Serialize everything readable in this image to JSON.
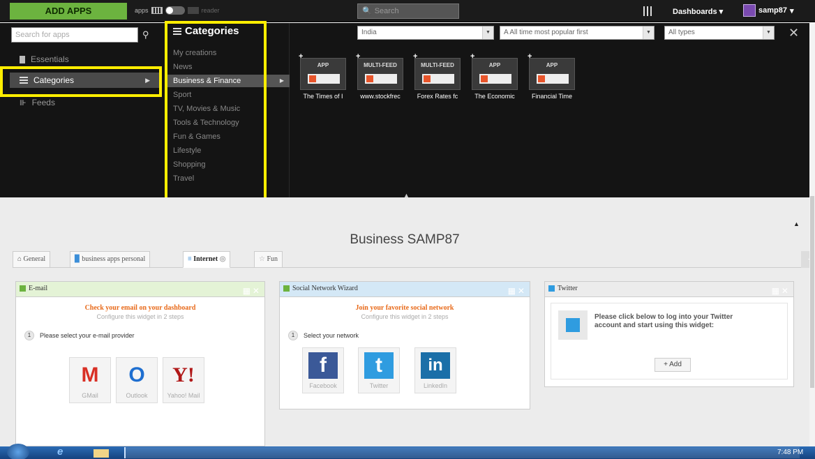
{
  "topbar": {
    "add_apps": "ADD APPS",
    "apps_label": "apps",
    "reader_label": "reader",
    "search_placeholder": "Search",
    "dashboards": "Dashboards",
    "user": "samp87"
  },
  "sidebar": {
    "search_placeholder": "Search for apps",
    "items": [
      {
        "label": "Essentials",
        "icon": "bookmark-icon"
      },
      {
        "label": "Categories",
        "icon": "list-icon",
        "selected": true
      },
      {
        "label": "Feeds",
        "icon": "rss-icon"
      }
    ]
  },
  "categories": {
    "title": "Categories",
    "items": [
      "My creations",
      "News",
      "Business & Finance",
      "Sport",
      "TV, Movies & Music",
      "Tools & Technology",
      "Fun & Games",
      "Lifestyle",
      "Shopping",
      "Travel"
    ],
    "selected": "Business & Finance"
  },
  "filters": {
    "region": "India",
    "sort": "All time most popular first",
    "sort_letter": "A",
    "type": "All types"
  },
  "apps": [
    {
      "type": "APP",
      "name": "The Times of I"
    },
    {
      "type": "MULTI-FEED",
      "name": "www.stockfrec"
    },
    {
      "type": "MULTI-FEED",
      "name": "Forex Rates fc"
    },
    {
      "type": "APP",
      "name": "The Economic"
    },
    {
      "type": "APP",
      "name": "Financial Time"
    }
  ],
  "dashboard": {
    "title": "Business SAMP87",
    "tabs": [
      {
        "label": "General"
      },
      {
        "label": "business apps personal"
      },
      {
        "label": "Internet",
        "active": true
      },
      {
        "label": "Fun"
      }
    ]
  },
  "widgets": {
    "email": {
      "title": "E-mail",
      "prompt": "Check your email on your dashboard",
      "subtitle": "Configure this widget in 2 steps",
      "step_num": "1",
      "step": "Please select your e-mail provider",
      "providers": [
        {
          "name": "GMail",
          "color": "#d93025"
        },
        {
          "name": "Outlook",
          "color": "#1f6fd0"
        },
        {
          "name": "Yahoo! Mail",
          "color": "#b01818"
        }
      ],
      "provider_logos": [
        "M",
        "O",
        "Y!"
      ]
    },
    "social": {
      "title": "Social Network Wizard",
      "prompt": "Join your favorite social network",
      "subtitle": "Configure this widget in 2 steps",
      "step_num": "1",
      "step": "Select your network",
      "networks": [
        {
          "name": "Facebook",
          "color": "#3b5998"
        },
        {
          "name": "Twitter",
          "color": "#2f9ce0"
        },
        {
          "name": "LinkedIn",
          "color": "#1b6fa8"
        }
      ],
      "network_logos": [
        "f",
        "t",
        "in"
      ]
    },
    "twitter": {
      "title": "Twitter",
      "message": "Please click below to log into your Twitter account and start using this widget:",
      "add": "+ Add"
    }
  },
  "taskbar": {
    "time": "7:48 PM"
  },
  "colors": {
    "add_apps_green": "#6cb33f",
    "highlight_yellow": "#ffee00",
    "prompt_orange": "#e86a1a"
  }
}
